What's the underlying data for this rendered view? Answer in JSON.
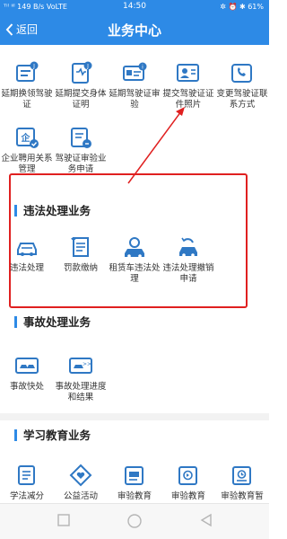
{
  "status_bar": {
    "left": "ᵀⁱˡ ᴵⁱˡ 149 B/s VoLTE",
    "time": "14:50",
    "right": "✲ ⏰ ✱ 61%"
  },
  "header": {
    "back_label": "返回",
    "title": "业务中心"
  },
  "license": {
    "items": [
      {
        "label": "延期换领驾驶证",
        "icon": "license-renew-icon"
      },
      {
        "label": "延期提交身体证明",
        "icon": "health-cert-icon"
      },
      {
        "label": "延期驾驶证审验",
        "icon": "license-audit-icon"
      },
      {
        "label": "提交驾驶证证件照片",
        "icon": "photo-id-icon"
      },
      {
        "label": "变更驾驶证联系方式",
        "icon": "phone-change-icon"
      },
      {
        "label": "企业聘用关系管理",
        "icon": "enterprise-icon"
      },
      {
        "label": "驾驶证审验业务申请",
        "icon": "audit-apply-icon"
      }
    ]
  },
  "violation": {
    "title": "违法处理业务",
    "items": [
      {
        "label": "违法处理",
        "icon": "car-violation-icon"
      },
      {
        "label": "罚款缴纳",
        "icon": "fine-scroll-icon"
      },
      {
        "label": "租赁车违法处理",
        "icon": "rental-car-icon"
      },
      {
        "label": "违法处理撤销申请",
        "icon": "revoke-icon"
      }
    ]
  },
  "accident": {
    "title": "事故处理业务",
    "items": [
      {
        "label": "事故快处",
        "icon": "quick-accident-icon"
      },
      {
        "label": "事故处理进度和结果",
        "icon": "accident-progress-icon"
      }
    ]
  },
  "education": {
    "title": "学习教育业务",
    "items": [
      {
        "label": "学法减分",
        "icon": "study-icon"
      },
      {
        "label": "公益活动",
        "icon": "charity-icon"
      },
      {
        "label": "审验教育",
        "icon": "audit-edu-icon"
      },
      {
        "label": "审验教育",
        "icon": "audit-edu-2-icon"
      },
      {
        "label": "审验教育暂",
        "icon": "audit-edu-3-icon"
      }
    ]
  },
  "colors": {
    "primary": "#2d8ae6",
    "icon_blue": "#2f78c4",
    "highlight": "#e02020"
  }
}
